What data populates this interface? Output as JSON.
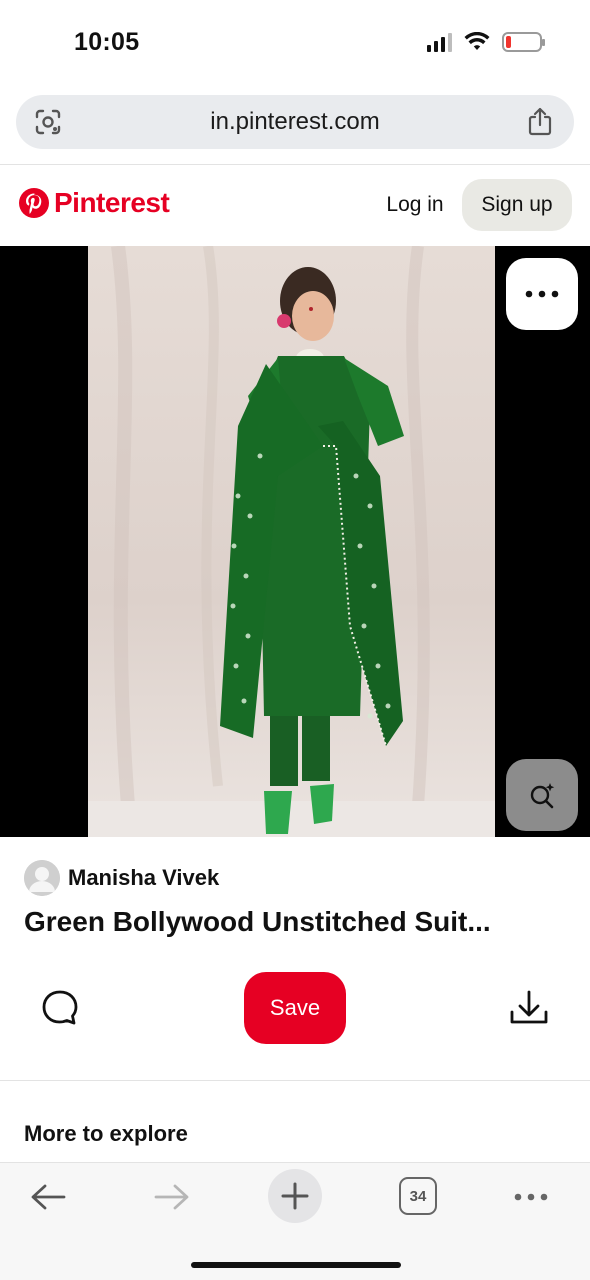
{
  "status_bar": {
    "time": "10:05",
    "battery_level": 0.15,
    "battery_color": "#f0342e"
  },
  "browser": {
    "url": "in.pinterest.com",
    "left_icon": "visual-search-icon",
    "right_icon": "share-icon",
    "tab_count": "34"
  },
  "header": {
    "brand": "Pinterest",
    "brand_color": "#e60023",
    "login_label": "Log in",
    "signup_label": "Sign up"
  },
  "pin": {
    "author": "Manisha Vivek",
    "title": "Green Bollywood Unstitched Suit...",
    "save_label": "Save",
    "save_color": "#e60023"
  },
  "section": {
    "more_to_explore": "More to explore"
  },
  "icons": {
    "comment": "comment-icon",
    "download": "download-icon",
    "more": "ellipsis-icon",
    "lens": "lens-icon",
    "back": "back-arrow-icon",
    "forward": "forward-arrow-icon",
    "new_tab": "plus-icon",
    "menu": "ellipsis-icon"
  }
}
